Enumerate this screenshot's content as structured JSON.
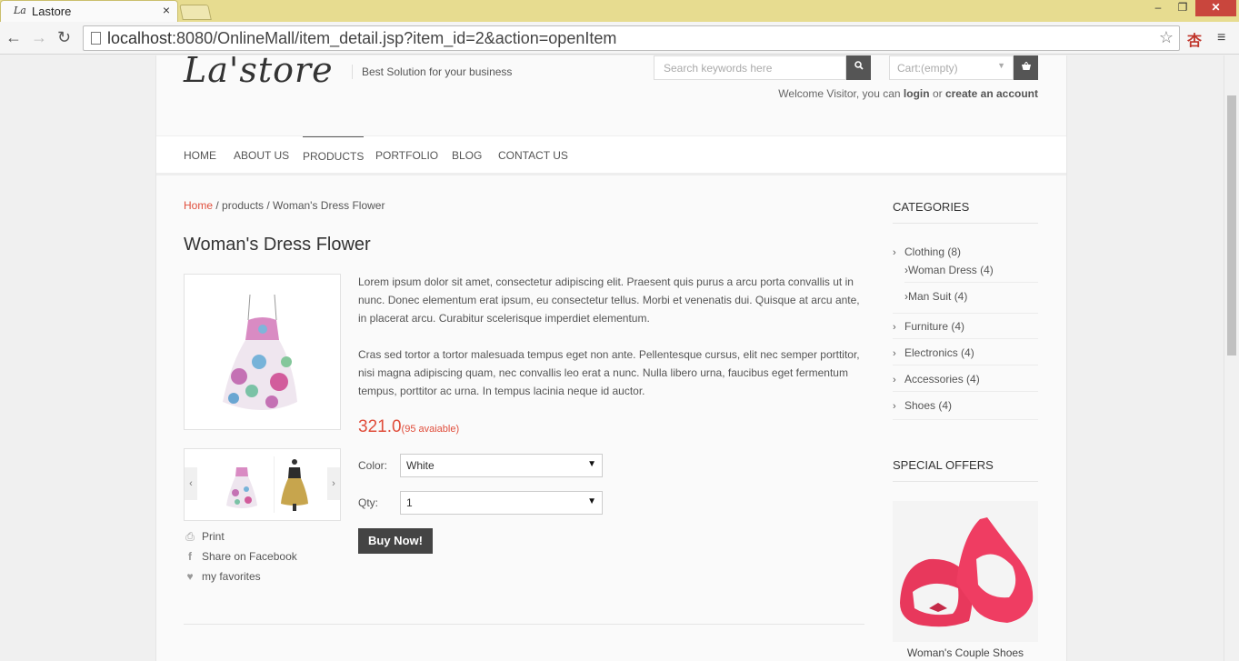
{
  "browser": {
    "tab_title": "Lastore",
    "tab_favicon": "La",
    "url_host": "localhost",
    "url_rest": ":8080/OnlineMall/item_detail.jsp?item_id=2&action=openItem",
    "ext_glyph": "杏"
  },
  "header": {
    "logo": "La'store",
    "tagline": "Best Solution for your business",
    "search_placeholder": "Search keywords here",
    "cart_label": "Cart:(empty)",
    "welcome_prefix": "Welcome Visitor, you can",
    "login": "login",
    "or": "or",
    "create_account": "create an account"
  },
  "nav": [
    "HOME",
    "ABOUT US",
    "PRODUCTS",
    "PORTFOLIO",
    "BLOG",
    "CONTACT US"
  ],
  "breadcrumb": {
    "home": "Home",
    "rest": " / products / Woman's Dress Flower"
  },
  "product": {
    "title": "Woman's Dress Flower",
    "description": [
      "Lorem ipsum dolor sit amet, consectetur adipiscing elit. Praesent quis purus a arcu porta convallis ut in nunc. Donec elementum erat ipsum, eu consectetur tellus. Morbi et venenatis dui. Quisque at arcu ante, in placerat arcu. Curabitur scelerisque imperdiet elementum.",
      "Cras sed tortor a tortor malesuada tempus eget non ante. Pellentesque cursus, elit nec semper porttitor, nisi magna adipiscing quam, nec convallis leo erat a nunc. Nulla libero urna, faucibus eget fermentum tempus, porttitor ac urna. In tempus lacinia neque id auctor."
    ],
    "price": "321.0",
    "availability": "(95 avaiable)",
    "color_label": "Color:",
    "color_value": "White",
    "qty_label": "Qty:",
    "qty_value": "1",
    "buy_label": "Buy Now!",
    "actions": {
      "print": "Print",
      "facebook": "Share on Facebook",
      "favorites": "my favorites"
    }
  },
  "sidebar": {
    "categories_title": "CATEGORIES",
    "categories": [
      {
        "label": "Clothing (8)"
      },
      {
        "label": "Woman Dress (4)",
        "sub": true
      },
      {
        "label": "Man Suit (4)",
        "sub": true
      },
      {
        "label": "Furniture (4)"
      },
      {
        "label": "Electronics (4)"
      },
      {
        "label": "Accessories (4)"
      },
      {
        "label": "Shoes (4)"
      }
    ],
    "offers_title": "SPECIAL OFFERS",
    "offer_caption": "Woman's Couple Shoes"
  },
  "colors": {
    "accent": "#e04e3c",
    "dark_button": "#444444",
    "chrome_tab": "#e7dc90"
  }
}
